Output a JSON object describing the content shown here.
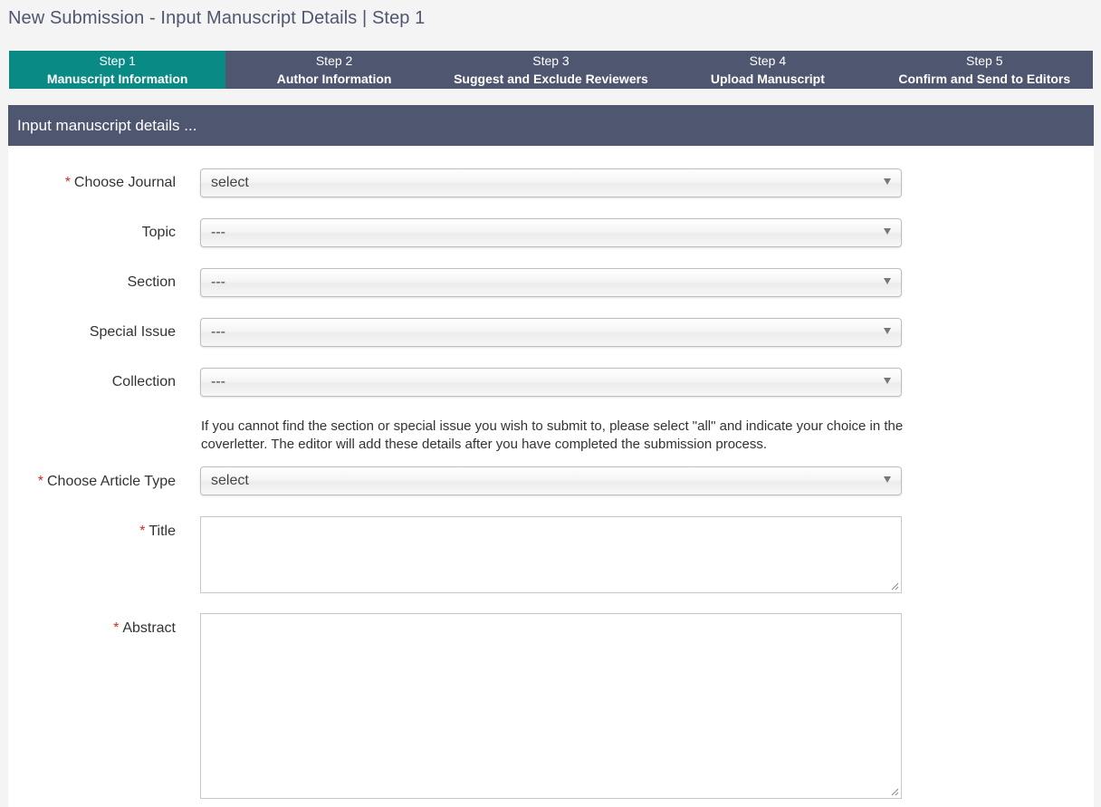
{
  "page": {
    "title": "New Submission - Input Manuscript Details | Step 1"
  },
  "steps": [
    {
      "num": "Step 1",
      "label": "Manuscript Information",
      "active": true
    },
    {
      "num": "Step 2",
      "label": "Author Information",
      "active": false
    },
    {
      "num": "Step 3",
      "label": "Suggest and Exclude Reviewers",
      "active": false
    },
    {
      "num": "Step 4",
      "label": "Upload Manuscript",
      "active": false
    },
    {
      "num": "Step 5",
      "label": "Confirm and Send to Editors",
      "active": false
    }
  ],
  "panel": {
    "header": "Input manuscript details ..."
  },
  "form": {
    "required_mark": "*",
    "journal": {
      "label": "Choose Journal",
      "value": "select"
    },
    "topic": {
      "label": "Topic",
      "value": "---"
    },
    "section": {
      "label": "Section",
      "value": "---"
    },
    "special_issue": {
      "label": "Special Issue",
      "value": "---"
    },
    "collection": {
      "label": "Collection",
      "value": "---"
    },
    "help_text": "If you cannot find the section or special issue you wish to submit to, please select \"all\" and indicate your choice in the coverletter. The editor will add these details after you have completed the submission process.",
    "article_type": {
      "label": "Choose Article Type",
      "value": "select"
    },
    "title": {
      "label": "Title",
      "value": ""
    },
    "abstract": {
      "label": "Abstract",
      "value": ""
    }
  },
  "colors": {
    "active_step": "#098a85",
    "header_bg": "#4f566f",
    "required": "#c9302c"
  }
}
